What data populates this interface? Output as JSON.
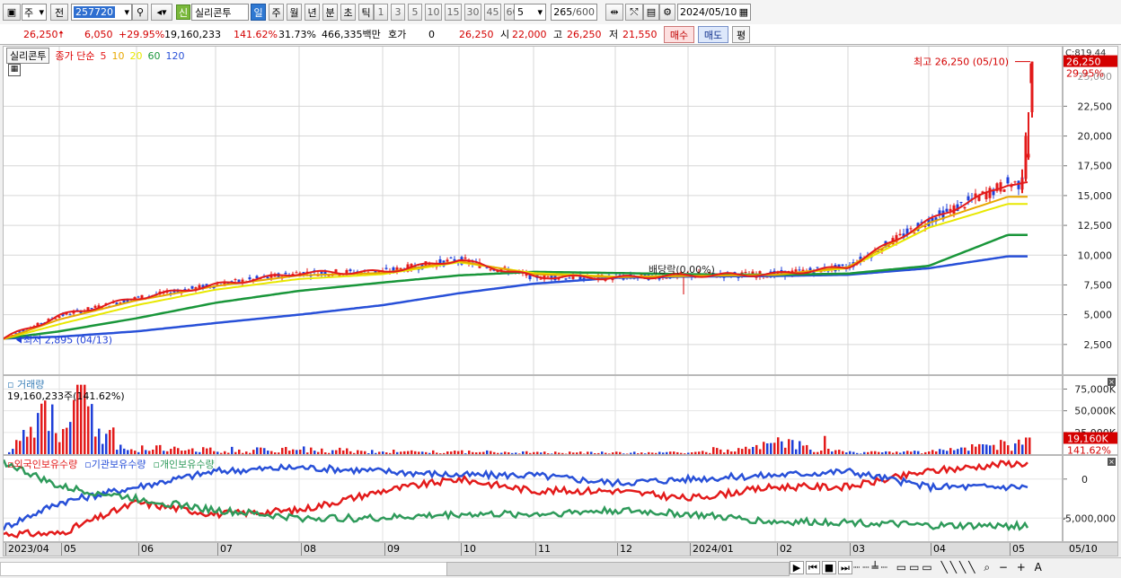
{
  "toolbar": {
    "type_label": "주",
    "jeon_label": "전",
    "code": "257720",
    "credit_badge": "신",
    "stock_name": "실리콘투",
    "periods": [
      "일",
      "주",
      "월",
      "년",
      "분",
      "초",
      "틱"
    ],
    "active_period": "일",
    "intervals": [
      "1",
      "3",
      "5",
      "10",
      "15",
      "30",
      "45",
      "60"
    ],
    "interval_value": "5",
    "count": "265",
    "count_max": "/600",
    "date": "2024/05/10"
  },
  "quote": {
    "price": "26,250",
    "change": "6,050",
    "change_pct": "+29.95%",
    "volume": "19,160,233",
    "volume_ratio": "141.62%",
    "turnover": "31.73%",
    "amount": "466,335백만",
    "hoga_label": "호가",
    "hoga_value": "0",
    "hoga_price": "26,250",
    "open_label": "시",
    "open": "22,000",
    "high_label": "고",
    "high": "26,250",
    "low_label": "저",
    "low": "21,550",
    "buy_button": "매수",
    "sell_button": "매도",
    "eval_button": "평"
  },
  "price_panel": {
    "legend_name": "실리콘투",
    "legend_ma": "종가 단순",
    "ma_periods": [
      "5",
      "10",
      "20",
      "60",
      "120"
    ],
    "ma_colors": [
      "#e31b1b",
      "#e8a800",
      "#e8e800",
      "#19963a",
      "#2850d8"
    ],
    "y_ticks": [
      "22,500",
      "20,000",
      "17,500",
      "15,000",
      "12,500",
      "10,000",
      "7,500",
      "5,000",
      "2,500"
    ],
    "top_tick_partial": "C:819.44",
    "last_price_tag": "26,250",
    "last_pct_tag": "29.95%",
    "high_annotation": "최고 26,250 (05/10)",
    "low_annotation": "최저 2,895 (04/13)",
    "dividend_annotation": "배당락(0.00%)"
  },
  "volume_panel": {
    "title": "거래량",
    "summary": "19,160,233주(141.62%)",
    "y_ticks": [
      "75,000K",
      "50,000K",
      "25,000K"
    ],
    "last_tag": "19,160K",
    "last_pct": "141.62%"
  },
  "holdings_panel": {
    "legend": [
      {
        "label": "외국인보유수량",
        "color": "#e31b1b"
      },
      {
        "label": "기관보유수량",
        "color": "#2850d8"
      },
      {
        "label": "개인보유수량",
        "color": "#2e9a5a"
      }
    ],
    "y_ticks": [
      "0",
      "-5,000,000"
    ]
  },
  "x_axis": {
    "labels": [
      "2023/04",
      "05",
      "06",
      "07",
      "08",
      "09",
      "10",
      "11",
      "12",
      "2024/01",
      "02",
      "03",
      "04",
      "05"
    ],
    "right_label": "05/10"
  },
  "chart_data": [
    {
      "type": "line",
      "title": "실리콘투",
      "x": [
        "2023/04",
        "2023/05",
        "2023/06",
        "2023/07",
        "2023/08",
        "2023/09",
        "2023/10",
        "2023/11",
        "2023/12",
        "2024/01",
        "2024/02",
        "2024/03",
        "2024/04",
        "2024/05/10"
      ],
      "series": [
        {
          "name": "5",
          "values": [
            3000,
            4900,
            6400,
            7500,
            8500,
            8600,
            9600,
            8200,
            8100,
            8300,
            8400,
            9000,
            12900,
            16000
          ]
        },
        {
          "name": "10",
          "values": [
            2950,
            4600,
            6200,
            7400,
            8300,
            8500,
            9500,
            8400,
            8150,
            8250,
            8350,
            9000,
            12700,
            14900
          ]
        },
        {
          "name": "20",
          "values": [
            2950,
            4200,
            5800,
            7100,
            8000,
            8400,
            9400,
            8500,
            8200,
            8250,
            8350,
            8900,
            12300,
            14300
          ]
        },
        {
          "name": "60",
          "values": [
            3000,
            3600,
            4700,
            6000,
            7000,
            7700,
            8300,
            8600,
            8500,
            8400,
            8350,
            8450,
            9100,
            11700
          ]
        },
        {
          "name": "120",
          "values": [
            3000,
            3150,
            3600,
            4300,
            5000,
            5800,
            6800,
            7600,
            8100,
            8200,
            8250,
            8350,
            8900,
            9900
          ]
        }
      ],
      "ylim": [
        0,
        27500
      ],
      "high": 26250,
      "low": 2895
    },
    {
      "type": "bar",
      "title": "거래량",
      "x": [
        "2023/04",
        "2023/05",
        "2023/06",
        "2023/07",
        "2023/08",
        "2023/09",
        "2023/10",
        "2023/11",
        "2023/12",
        "2024/01",
        "2024/02",
        "2024/03",
        "2024/04",
        "2024/05/10"
      ],
      "values": [
        4000,
        80000,
        12000,
        8000,
        9000,
        5000,
        5000,
        3000,
        3000,
        3000,
        20000,
        4000,
        4000,
        19160
      ],
      "ylim": [
        0,
        90000
      ]
    },
    {
      "type": "line",
      "title": "보유수량",
      "x": [
        "2023/04",
        "2023/05",
        "2023/06",
        "2023/07",
        "2023/08",
        "2023/09",
        "2023/10",
        "2023/11",
        "2023/12",
        "2024/01",
        "2024/02",
        "2024/03",
        "2024/04",
        "2024/05/10"
      ],
      "series": [
        {
          "name": "외국인보유수량",
          "values": [
            -7000000,
            -7000000,
            -3000000,
            -4500000,
            -4000000,
            -1500000,
            0,
            -1500000,
            -1500000,
            -2500000,
            -1000000,
            -1000000,
            1000000,
            2000000
          ]
        },
        {
          "name": "기관보유수량",
          "values": [
            -6200000,
            -3000000,
            -1000000,
            1000000,
            1500000,
            1000000,
            500000,
            500000,
            -500000,
            0,
            500000,
            1000000,
            -1000000,
            -1000000
          ]
        },
        {
          "name": "개인보유수량",
          "values": [
            2200000,
            -1000000,
            -2500000,
            -4000000,
            -5000000,
            -5000000,
            -4500000,
            -4500000,
            -4000000,
            -4500000,
            -5500000,
            -5500000,
            -6000000,
            -6000000
          ]
        }
      ],
      "ylim": [
        -7500000,
        2500000
      ]
    }
  ]
}
